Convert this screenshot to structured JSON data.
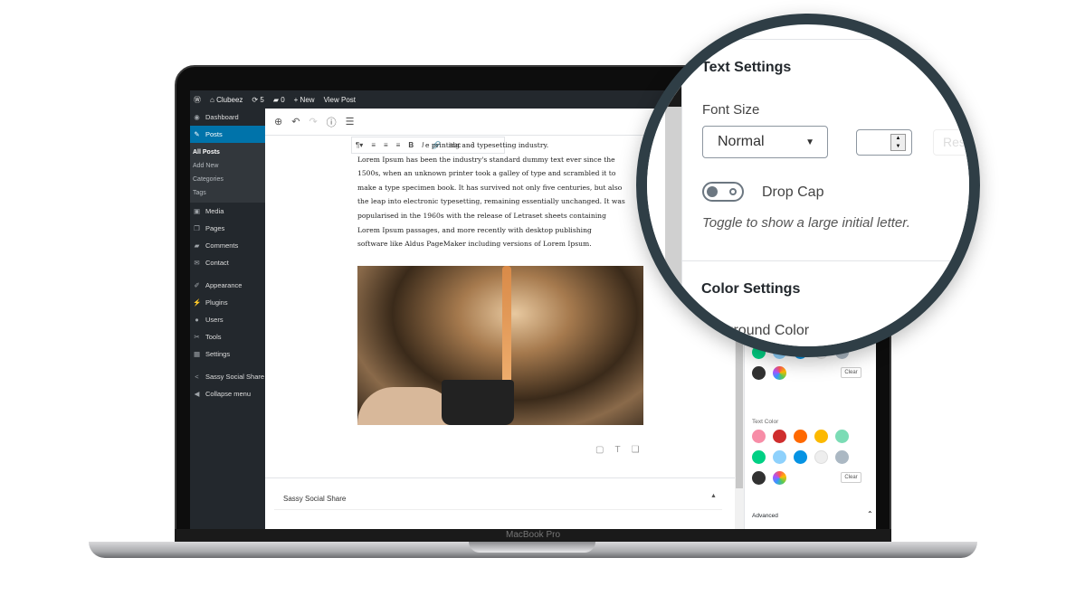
{
  "adminbar": {
    "site": "Clubeez",
    "updates": "5",
    "comments": "0",
    "new": "New",
    "view": "View Post"
  },
  "sidebar": {
    "items": [
      {
        "label": "Dashboard",
        "icon": "dashboard-icon",
        "glyph": "◉"
      },
      {
        "label": "Posts",
        "icon": "pin-icon",
        "glyph": "✎",
        "active": true
      },
      {
        "label": "Media",
        "icon": "media-icon",
        "glyph": "▣"
      },
      {
        "label": "Pages",
        "icon": "pages-icon",
        "glyph": "❐"
      },
      {
        "label": "Comments",
        "icon": "comments-icon",
        "glyph": "▰"
      },
      {
        "label": "Contact",
        "icon": "mail-icon",
        "glyph": "✉"
      },
      {
        "label": "Appearance",
        "icon": "brush-icon",
        "glyph": "✐"
      },
      {
        "label": "Plugins",
        "icon": "plugin-icon",
        "glyph": "⚡"
      },
      {
        "label": "Users",
        "icon": "user-icon",
        "glyph": "●"
      },
      {
        "label": "Tools",
        "icon": "wrench-icon",
        "glyph": "✂"
      },
      {
        "label": "Settings",
        "icon": "settings-icon",
        "glyph": "▦"
      },
      {
        "label": "Sassy Social Share",
        "icon": "share-icon",
        "glyph": "<"
      },
      {
        "label": "Collapse menu",
        "icon": "collapse-icon",
        "glyph": "◀"
      }
    ],
    "submenu": [
      "All Posts",
      "Add New",
      "Categories",
      "Tags"
    ]
  },
  "editor": {
    "paragraph": [
      "e printing and typesetting industry.",
      "Lorem Ipsum has been the industry's standard dummy text ever since the",
      "1500s, when an unknown printer took a galley of type and scrambled it to",
      "make a type specimen book. It has survived not only five centuries, but also",
      "the leap into electronic typesetting, remaining essentially unchanged. It was",
      "popularised in the 1960s with the release of Letraset sheets containing",
      "Lorem Ipsum passages, and more recently with desktop publishing",
      "software like Aldus PageMaker including versions of Lorem Ipsum."
    ],
    "metabox_title": "Sassy Social Share"
  },
  "panel": {
    "text_color_label": "Text Color",
    "clear": "Clear",
    "advanced": "Advanced",
    "bg_colors": [
      "#00d084",
      "#8ed1fc",
      "#0693e3",
      "#eeeeee",
      "#abb8c3",
      "#313131"
    ],
    "text_colors": [
      "#f78da7",
      "#cf2e2e",
      "#ff6900",
      "#fcb900",
      "#7bdcb5",
      "#00d084",
      "#8ed1fc",
      "#0693e3",
      "#eeeeee",
      "#abb8c3",
      "#313131"
    ]
  },
  "magnifier": {
    "text_settings": "Text Settings",
    "font_size": "Font Size",
    "font_size_value": "Normal",
    "reset": "Reset",
    "drop_cap": "Drop Cap",
    "drop_cap_help": "Toggle to show a large initial letter.",
    "drop_cap_on": false,
    "color_settings": "Color Settings",
    "background_color": "Background Color"
  },
  "device": {
    "label": "MacBook Pro"
  }
}
